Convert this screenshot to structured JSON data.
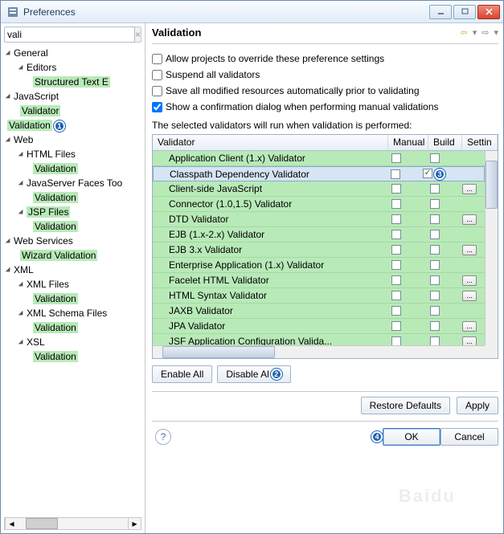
{
  "window": {
    "title": "Preferences"
  },
  "filter": {
    "value": "vali"
  },
  "tree": [
    {
      "label": "General",
      "level": 0,
      "expandable": true
    },
    {
      "label": "Editors",
      "level": 1,
      "expandable": true
    },
    {
      "label": "Structured Text E",
      "level": 2,
      "hl": true
    },
    {
      "label": "JavaScript",
      "level": 0,
      "expandable": true
    },
    {
      "label": "Validator",
      "level": 1,
      "hl": true
    },
    {
      "label": "Validation",
      "level": 0,
      "hl": true,
      "sel": true,
      "badge": "1"
    },
    {
      "label": "Web",
      "level": 0,
      "expandable": true
    },
    {
      "label": "HTML Files",
      "level": 1,
      "expandable": true
    },
    {
      "label": "Validation",
      "level": 2,
      "hl": true
    },
    {
      "label": "JavaServer Faces Too",
      "level": 1,
      "expandable": true
    },
    {
      "label": "Validation",
      "level": 2,
      "hl": true
    },
    {
      "label": "JSP Files",
      "level": 1,
      "expandable": true,
      "hl": true
    },
    {
      "label": "Validation",
      "level": 2,
      "hl": true
    },
    {
      "label": "Web Services",
      "level": 0,
      "expandable": true
    },
    {
      "label": "Wizard Validation",
      "level": 1,
      "hl": true
    },
    {
      "label": "XML",
      "level": 0,
      "expandable": true
    },
    {
      "label": "XML Files",
      "level": 1,
      "expandable": true
    },
    {
      "label": "Validation",
      "level": 2,
      "hl": true
    },
    {
      "label": "XML Schema Files",
      "level": 1,
      "expandable": true
    },
    {
      "label": "Validation",
      "level": 2,
      "hl": true
    },
    {
      "label": "XSL",
      "level": 1,
      "expandable": true
    },
    {
      "label": "Validation",
      "level": 2,
      "hl": true
    }
  ],
  "heading": "Validation",
  "options": {
    "override": {
      "label": "Allow projects to override these preference settings",
      "checked": false
    },
    "suspend": {
      "label": "Suspend all validators",
      "checked": false
    },
    "saveall": {
      "label": "Save all modified resources automatically prior to validating",
      "checked": false
    },
    "confirm": {
      "label": "Show a confirmation dialog when performing manual validations",
      "checked": true
    }
  },
  "table_caption": "The selected validators will run when validation is performed:",
  "columns": {
    "validator": "Validator",
    "manual": "Manual",
    "build": "Build",
    "settings": "Settin"
  },
  "validators": [
    {
      "name": "Application Client (1.x) Validator",
      "manual": false,
      "build": false,
      "settings": false
    },
    {
      "name": "Classpath Dependency Validator",
      "manual": false,
      "build": true,
      "settings": false,
      "selected": true,
      "badge": "3"
    },
    {
      "name": "Client-side JavaScript",
      "manual": false,
      "build": false,
      "settings": true
    },
    {
      "name": "Connector (1.0,1.5) Validator",
      "manual": false,
      "build": false,
      "settings": false
    },
    {
      "name": "DTD Validator",
      "manual": false,
      "build": false,
      "settings": true
    },
    {
      "name": "EJB (1.x-2.x) Validator",
      "manual": false,
      "build": false,
      "settings": false
    },
    {
      "name": "EJB 3.x Validator",
      "manual": false,
      "build": false,
      "settings": true
    },
    {
      "name": "Enterprise Application (1.x) Validator",
      "manual": false,
      "build": false,
      "settings": false
    },
    {
      "name": "Facelet HTML Validator",
      "manual": false,
      "build": false,
      "settings": true
    },
    {
      "name": "HTML Syntax Validator",
      "manual": false,
      "build": false,
      "settings": true
    },
    {
      "name": "JAXB Validator",
      "manual": false,
      "build": false,
      "settings": false
    },
    {
      "name": "JPA Validator",
      "manual": false,
      "build": false,
      "settings": true
    },
    {
      "name": "JSF Application Configuration Valida...",
      "manual": false,
      "build": false,
      "settings": true
    }
  ],
  "buttons": {
    "enable_all": "Enable All",
    "disable_all": "Disable Al",
    "disable_badge": "2",
    "restore": "Restore Defaults",
    "apply": "Apply",
    "ok": "OK",
    "ok_badge": "4",
    "cancel": "Cancel"
  },
  "watermark": "Baidu"
}
